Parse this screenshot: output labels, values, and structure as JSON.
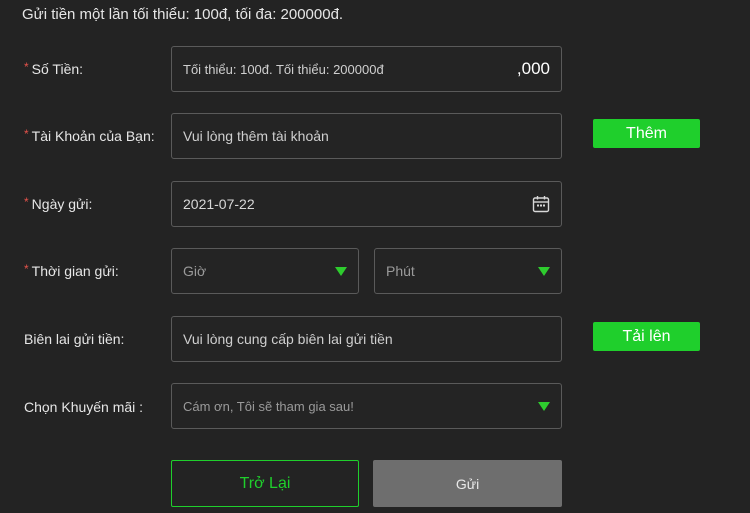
{
  "notice": "Gửi tiền một lần tối thiểu: 100đ, tối đa: 200000đ.",
  "required_mark": "*",
  "amount": {
    "label": "Số Tiền:",
    "placeholder": "Tối thiểu: 100đ. Tối thiểu: 200000đ",
    "suffix": ",000"
  },
  "account": {
    "label": "Tài Khoản của Bạn:",
    "placeholder": "Vui lòng thêm tài khoản",
    "add_button": "Thêm"
  },
  "date": {
    "label": "Ngày gửi:",
    "value": "2021-07-22",
    "icon": "calendar-icon"
  },
  "time": {
    "label": "Thời gian gửi:",
    "hour_placeholder": "Giờ",
    "minute_placeholder": "Phút",
    "icon": "dropdown-triangle-icon"
  },
  "receipt": {
    "label": "Biên lai gửi tiền:",
    "placeholder": "Vui lòng cung cấp biên lai gửi tiền",
    "upload_button": "Tải lên"
  },
  "promo": {
    "label": "Chọn Khuyến mãi :",
    "selected": "Cám ơn, Tôi sẽ tham gia sau!"
  },
  "actions": {
    "back": "Trở Lại",
    "submit": "Gửi"
  },
  "colors": {
    "accent": "#1fcf2c",
    "required": "#e5534b",
    "background": "#232323",
    "disabled_button": "#6e6e6e"
  }
}
